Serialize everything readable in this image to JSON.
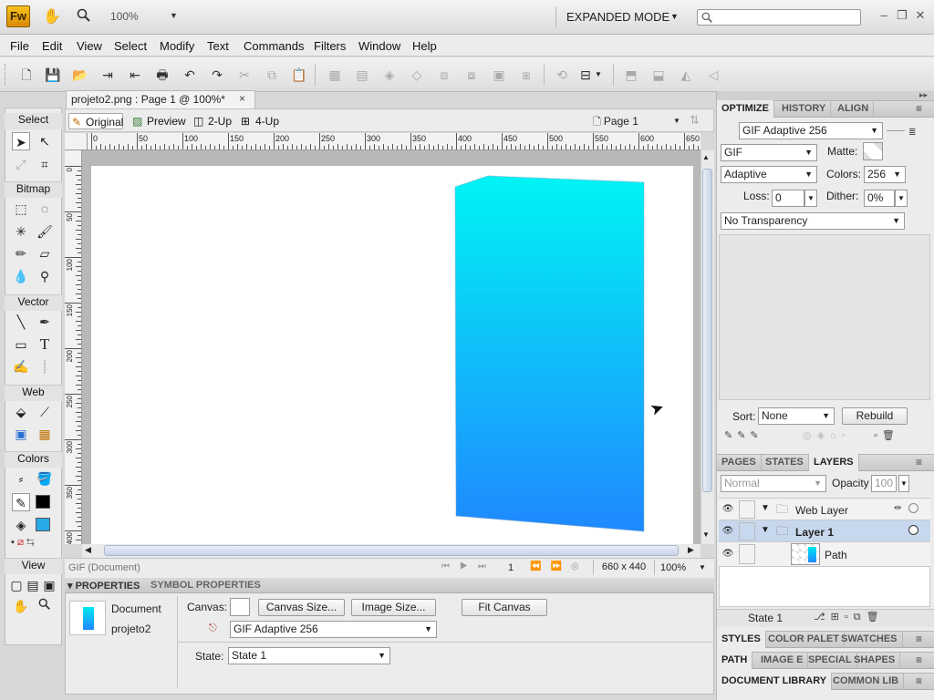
{
  "app": {
    "logo": "Fw",
    "zoom": "100%",
    "mode": "EXPANDED MODE"
  },
  "menu": [
    "File",
    "Edit",
    "View",
    "Select",
    "Modify",
    "Text",
    "Commands",
    "Filters",
    "Window",
    "Help"
  ],
  "document": {
    "tab_title": "projeto2.png : Page 1 @ 100%*",
    "close": "×"
  },
  "viewbar": {
    "original": "Original",
    "preview": "Preview",
    "two_up": "2-Up",
    "four_up": "4-Up",
    "page": "Page 1"
  },
  "hruler": [
    "0",
    "50",
    "100",
    "150",
    "200",
    "250",
    "300",
    "350",
    "400",
    "450",
    "500",
    "550",
    "600",
    "650"
  ],
  "vruler": [
    "0",
    "50",
    "100",
    "150",
    "200",
    "250",
    "300",
    "350",
    "400"
  ],
  "tools": {
    "select": "Select",
    "bitmap": "Bitmap",
    "vector": "Vector",
    "web": "Web",
    "colors": "Colors",
    "view": "View",
    "text_tool": "T"
  },
  "status": {
    "format": "GIF (Document)",
    "frame": "1",
    "dims": "660 x 440",
    "zoom": "100%"
  },
  "properties": {
    "tab1": "PROPERTIES",
    "tab2": "SYMBOL PROPERTIES",
    "doc_label": "Document",
    "doc_name": "projeto2",
    "canvas_label": "Canvas:",
    "canvas_size": "Canvas Size...",
    "image_size": "Image Size...",
    "fit_canvas": "Fit Canvas",
    "export_setting": "GIF Adaptive 256",
    "state_label": "State:",
    "state_value": "State 1"
  },
  "optimize": {
    "tabs": [
      "OPTIMIZE",
      "HISTORY",
      "ALIGN"
    ],
    "preset": "GIF Adaptive 256",
    "format": "GIF",
    "matte_label": "Matte:",
    "palette": "Adaptive",
    "colors_label": "Colors:",
    "colors": "256",
    "loss_label": "Loss:",
    "loss": "0",
    "dither_label": "Dither:",
    "dither": "0%",
    "transparency": "No Transparency",
    "sort_label": "Sort:",
    "sort": "None",
    "rebuild": "Rebuild"
  },
  "layers": {
    "tabs": [
      "PAGES",
      "STATES",
      "LAYERS"
    ],
    "blend": "Normal",
    "opacity_label": "Opacity",
    "opacity": "100",
    "rows": [
      {
        "name": "Web Layer"
      },
      {
        "name": "Layer 1"
      },
      {
        "name": "Path"
      }
    ],
    "state": "State 1"
  },
  "bottom_panels": {
    "row1": [
      "STYLES",
      "COLOR PALET",
      "SWATCHES"
    ],
    "row2": [
      "PATH",
      "IMAGE E",
      "SPECIAL",
      "SHAPES"
    ],
    "row3": [
      "DOCUMENT LIBRARY",
      "COMMON LIB"
    ]
  },
  "colors": {
    "gradient_top": "#00f4f4",
    "gradient_bottom": "#1f88ff",
    "fill_swatch": "#28a9e8",
    "stroke_swatch": "#000000"
  }
}
